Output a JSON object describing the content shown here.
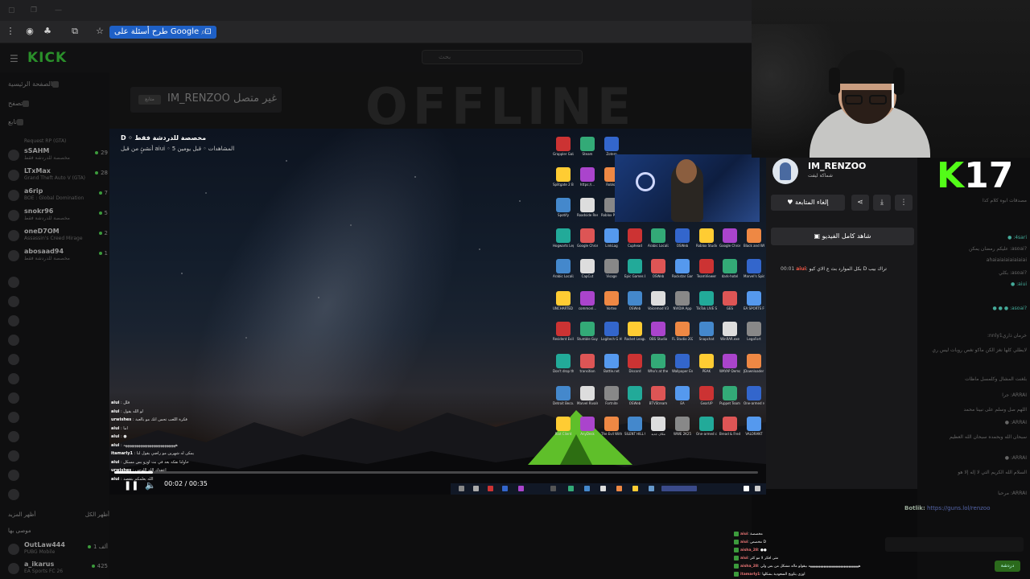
{
  "browser": {
    "search_pill": "طرح أسئلة على Google"
  },
  "kick": {
    "logo": "KICK",
    "search_placeholder": "بحث",
    "nav": [
      {
        "label": "الصفحة الرئيسية"
      },
      {
        "label": "تصفح"
      },
      {
        "label": "تابع"
      }
    ],
    "following": [
      {
        "name": "sSAHM",
        "sub": "مخصصة للدردشة فقط",
        "count": "29"
      },
      {
        "name": "LTxMax",
        "sub": "Grand Theft Auto V (GTA)",
        "count": "28"
      },
      {
        "name": "a6rip",
        "sub": "BOE : Global Domination",
        "count": "7"
      },
      {
        "name": "snokr96",
        "sub": "مخصصة للدردشة فقط",
        "count": "5"
      },
      {
        "name": "oneD7OM",
        "sub": "Assassin's Creed Mirage",
        "count": "2"
      },
      {
        "name": "abosaad94",
        "sub": "مخصصة للدردشة فقط",
        "count": "1"
      }
    ],
    "sidebar_top_sub": "Request RP (GTA)",
    "show_more": "أظهر المزيد",
    "show_all": "أظهر الكل",
    "recommended": "موصى بها",
    "recommended_rows": [
      {
        "name": "OutLaw444",
        "sub": "PUBG Mobile",
        "count": "1 ألف"
      },
      {
        "name": "a_ikarus",
        "sub": "EA Sports FC 26",
        "count": "425"
      }
    ],
    "offline_label": "OFFLINE",
    "offline_channel": "IM_RENZOO",
    "offline_status": "غير متصل",
    "offline_tag": "متابع"
  },
  "clip": {
    "title": "مخصصة للدردشة فقط ◦ D",
    "meta": "المشاهدات ◦ قبل يومين 5 ◦ aiui أنشئ من قبل",
    "time": "00:02 / 00:35",
    "progress_percent": 6,
    "desktop_icons": [
      "Grappler Galaxy",
      "Steam",
      "Zotero",
      "Splitgate 2 Beta",
      "https://...",
      "Roblox",
      "Spotify",
      "Roadside Research",
      "Roblox Player",
      "Hogwarts Legacy",
      "Google Chrome",
      "LinkLag",
      "Cuphead",
      "Arabic Localizatio",
      "OSWeb",
      "Roblox Studio",
      "Google Chrome",
      "Black and White Veil",
      "Arabic Localizatio",
      "CapCut",
      "Visage",
      "Epic Games Launcher",
      "OSWeb",
      "Rockstar Games",
      "TeamViewer",
      "dark-hotel",
      "Marvel's Spider-M",
      "UNCHARTED Legacy",
      "commonl...",
      "Vortex",
      "OSWeb",
      "Voicemod V3",
      "NVIDIA App",
      "TikTok LIVE Studio",
      "GES",
      "EA SPORTS FC 25",
      "Resident Evil 4",
      "Stumble Guys",
      "Logitech G HUB",
      "Rocket League",
      "OBS Studio",
      "FL Studio 2025",
      "Snapchat",
      "WinRAR.exe",
      "LegoFort",
      "Don't drop the cake",
      "transition",
      "Battle.net",
      "Discord",
      "Who's at the door Demo",
      "Wallpaper Engine",
      "PEAK",
      "WAYAP Demo",
      "JDownloader 2",
      "Detroit Beco...",
      "Marvel Rivals",
      "Fortnite",
      "OSWeb",
      "BTVStream",
      "EA",
      "GearUP",
      "Puppet Team",
      "One-armed robber",
      "Riot Client",
      "AnyDesk",
      "The Evil Within",
      "SILENT HILL f",
      "مكان جديد",
      "WWE 2K25",
      "One-armed cook",
      "Bread & Fred Demo",
      "VALORANT"
    ],
    "chat": [
      {
        "user": "aiui",
        "text": "قلل"
      },
      {
        "user": "aiui",
        "text": "لو الله يقول"
      },
      {
        "user": "urwishes",
        "text": "فكرة اللعب تحس انك مو بالعبة"
      },
      {
        "user": "aiui",
        "text": "اما"
      },
      {
        "user": "aiui",
        "text": "●"
      },
      {
        "user": "aiui",
        "text": "ههههههههههههههههههههههههههههه"
      },
      {
        "user": "itamarly1",
        "text": "يمكن له شهرين مو راضي يقول لنا"
      },
      {
        "user": "aiui",
        "text": "حاولنا نفكه بعد في بث اوزو بس مسكل"
      },
      {
        "user": "urwishes",
        "text": "اعقدك الله اللوحي"
      },
      {
        "user": "aiui",
        "text": "الله يعلمكم بتقصد"
      }
    ]
  },
  "channel_panel": {
    "name": "IM_RENZOO",
    "subtitle": "شماكة ليفت",
    "unfollow": "إلغاء المتابعة",
    "watch_full": "شاهد كامل الفيديو",
    "message_time": "00:01",
    "message_user": "aiui",
    "message_text": "بكل الموارد بث ع الاي كيو D تراك بيب"
  },
  "right_chat": {
    "badge_k": "K",
    "badge_num": "17",
    "lines": [
      "مصدقات ابوه كلام كذا",
      "4sari: ●",
      "?asoai: عليكم رمضان يمكن",
      "ahaiaiaiaiaiaiaiai",
      "?asoai: بكلي",
      "aiui: ●",
      "?asoai: ● ● ●",
      "خرمان ذاري‌nnly1:",
      "لايطلي كلها نغز الكن ماكو نغص روبات ليس ري",
      "بلغنت المشال وكلمسل ماظات",
      "ARRAI: جرا",
      "اللهم صل وسلم على نبينا محمد",
      "ARRAI: ●",
      "سبحان الله وبحمده سبحان الله العظيم",
      "ARRAI: ●",
      "السلام الله الكريم التي لا إله إلا هو",
      "ARRAI: مرحبا"
    ],
    "link_user": "Botlik:",
    "link_text": "https://guns.lol/renzoo",
    "send": "دردشة"
  },
  "overlay_chat": [
    {
      "user": "aiui",
      "text": "مخصصة"
    },
    {
      "user": "aiui",
      "text": "مخصص D"
    },
    {
      "user": "aisha_28",
      "text": "●●"
    },
    {
      "user": "aiui",
      "text": "متى افكر لا مو كثر"
    },
    {
      "user": "aisha_28",
      "text": "ههههههههههههههههههههههههههههههه بيقولو ماله مشكل من بس ولي"
    },
    {
      "user": "itamarly1",
      "text": "اوزي يتاويخ السعودية بشكلها"
    }
  ]
}
